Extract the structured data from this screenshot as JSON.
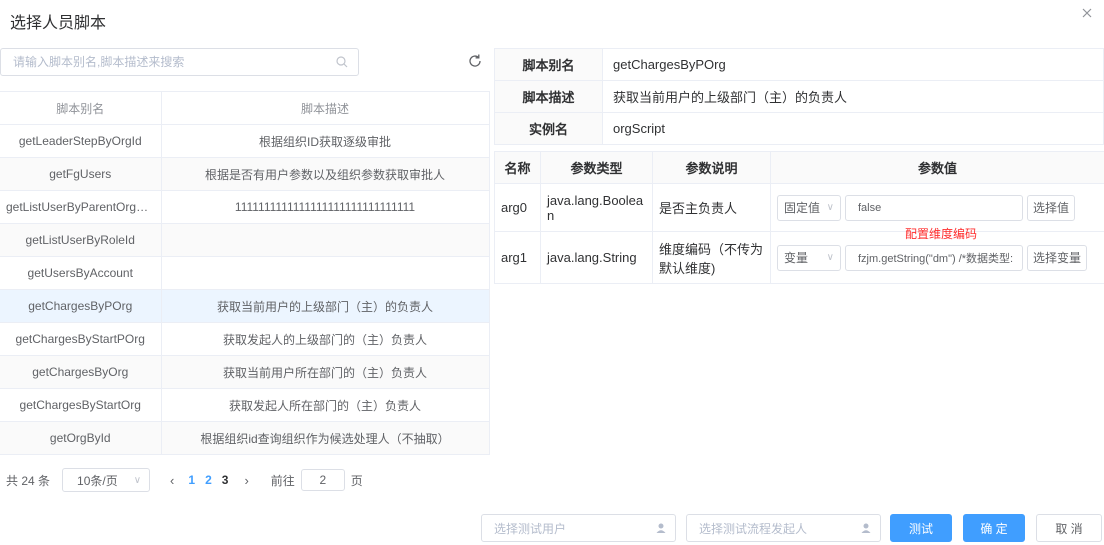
{
  "dialog": {
    "title": "选择人员脚本"
  },
  "search": {
    "placeholder": "请输入脚本别名,脚本描述来搜索",
    "value": ""
  },
  "left_table": {
    "headers": [
      "脚本别名",
      "脚本描述"
    ],
    "rows": [
      {
        "alias": "getLeaderStepByOrgId",
        "desc": "根据组织ID获取逐级审批"
      },
      {
        "alias": "getFgUsers",
        "desc": "根据是否有用户参数以及组织参数获取审批人"
      },
      {
        "alias": "getListUserByParentOrgR...",
        "desc": "1111111111111111111111111111111"
      },
      {
        "alias": "getListUserByRoleId",
        "desc": ""
      },
      {
        "alias": "getUsersByAccount",
        "desc": ""
      },
      {
        "alias": "getChargesByPOrg",
        "desc": "获取当前用户的上级部门（主）的负责人"
      },
      {
        "alias": "getChargesByStartPOrg",
        "desc": "获取发起人的上级部门的（主）负责人"
      },
      {
        "alias": "getChargesByOrg",
        "desc": "获取当前用户所在部门的（主）负责人"
      },
      {
        "alias": "getChargesByStartOrg",
        "desc": "获取发起人所在部门的（主）负责人"
      },
      {
        "alias": "getOrgById",
        "desc": "根据组织id查询组织作为候选处理人（不抽取）"
      }
    ],
    "selected_index": 5
  },
  "pagination": {
    "total": "共 24 条",
    "page_size": "10条/页",
    "prev": "‹",
    "pages": [
      "1",
      "2",
      "3"
    ],
    "active_page": "1",
    "next": "›",
    "goto_label": "前往",
    "goto_value": "2",
    "goto_suffix": "页"
  },
  "script_info": {
    "alias_label": "脚本别名",
    "alias_value": "getChargesByPOrg",
    "desc_label": "脚本描述",
    "desc_value": "获取当前用户的上级部门（主）的负责人",
    "instance_label": "实例名",
    "instance_value": "orgScript"
  },
  "params": {
    "headers": [
      "名称",
      "参数类型",
      "参数说明",
      "参数值"
    ],
    "rows": [
      {
        "name": "arg0",
        "type": "java.lang.Boolean",
        "desc": "是否主负责人",
        "mode": "固定值",
        "value": "false",
        "button": "选择值"
      },
      {
        "name": "arg1",
        "type": "java.lang.String",
        "desc": "维度编码（不传为默认维度)",
        "mode": "变量",
        "value": "fzjm.getString(\"dm\") /*数据类型:",
        "button": "选择变量"
      }
    ],
    "annotation": "配置维度编码"
  },
  "footer": {
    "test_user_placeholder": "选择测试用户",
    "test_starter_placeholder": "选择测试流程发起人",
    "test_label": "测试",
    "confirm_label": "确 定",
    "cancel_label": "取 消"
  },
  "colors": {
    "primary": "#409eff",
    "annotation": "#ff2d2d",
    "selected_row": "#ecf5ff"
  }
}
